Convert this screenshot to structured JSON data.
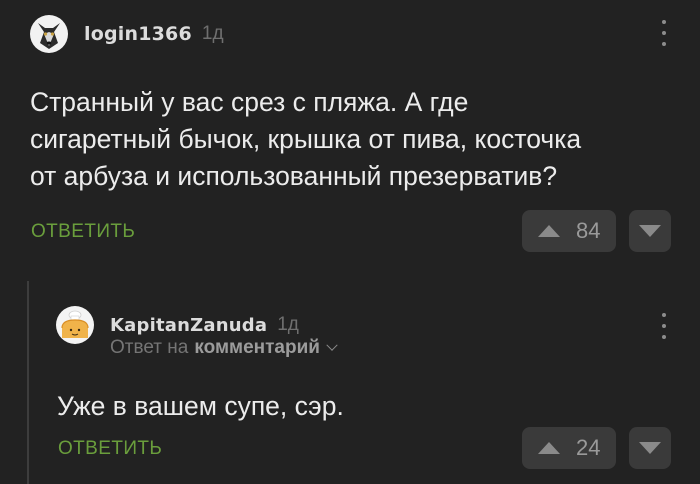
{
  "comments": [
    {
      "username": "login1366",
      "time": "1д",
      "text_lines": [
        "Странный у вас срез с пляжа. А где",
        "сигаретный бычок, крышка от пива, косточка",
        "от арбуза и использованный презерватив?"
      ],
      "reply_label": "ОТВЕТИТЬ",
      "rating": "84",
      "avatar_icon": "dog-avatar"
    },
    {
      "username": "KapitanZanuda",
      "time": "1д",
      "reply_to_prefix": "Ответ на",
      "reply_to_target": "комментарий",
      "text_lines": [
        "Уже в вашем супе, сэр."
      ],
      "reply_label": "ОТВЕТИТЬ",
      "rating": "24",
      "avatar_icon": "chef-bread-avatar"
    }
  ],
  "colors": {
    "background": "#222222",
    "accent_green": "#6a9e3c",
    "button_bg": "#3a3a3a"
  }
}
